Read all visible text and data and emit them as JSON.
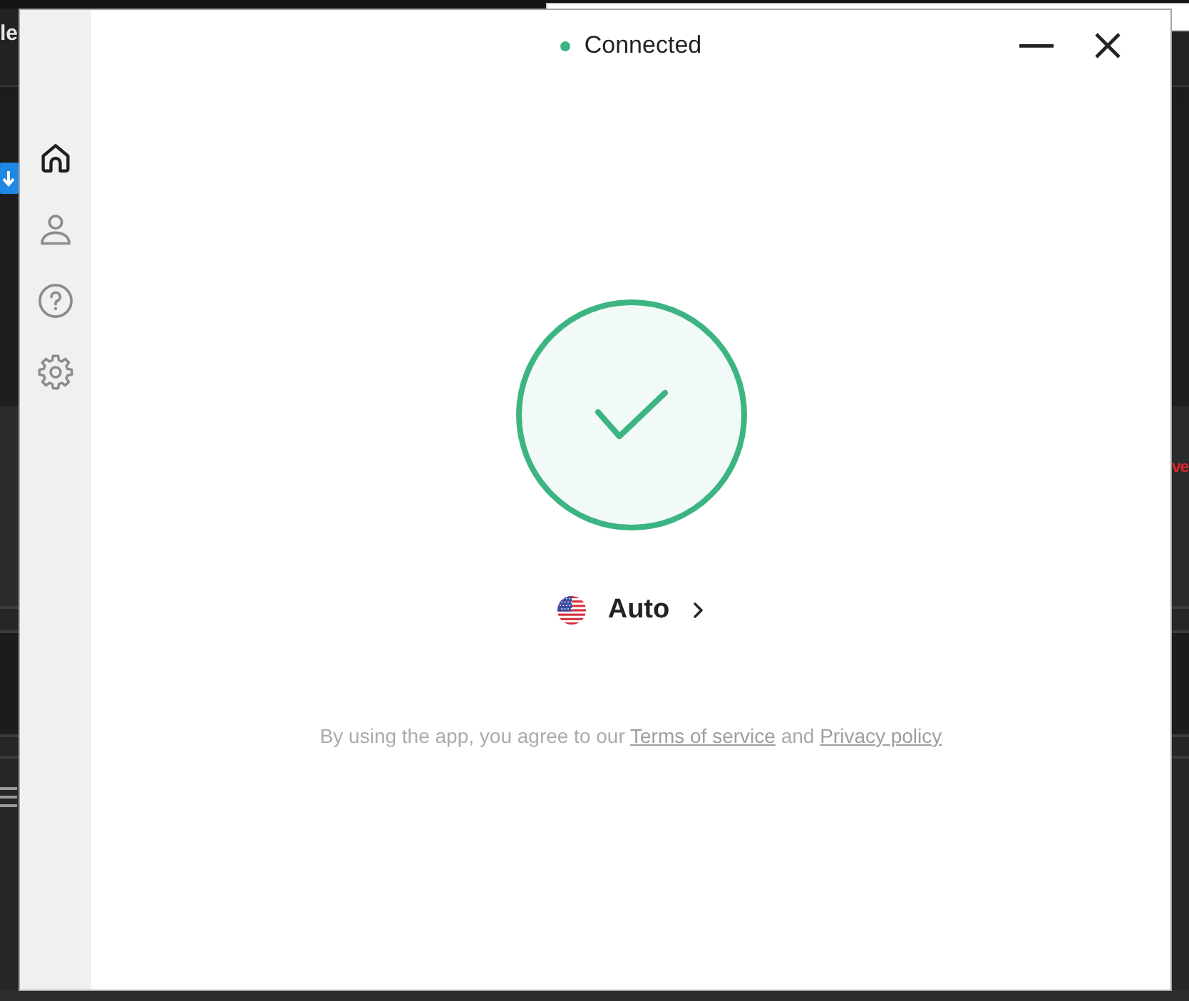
{
  "background_window": {
    "title_fragment": "le",
    "alert_fragment": "ve"
  },
  "sidebar": {
    "items": [
      {
        "kind": "home",
        "selected": true
      },
      {
        "kind": "profile",
        "selected": false
      },
      {
        "kind": "help",
        "selected": false
      },
      {
        "kind": "settings",
        "selected": false
      }
    ]
  },
  "status": {
    "text": "Connected",
    "connected": true
  },
  "location": {
    "label": "Auto"
  },
  "legal": {
    "parts": [
      {
        "kind": "text",
        "text": "By using the app, you agree to our"
      },
      {
        "kind": "link",
        "text": "Terms of service"
      },
      {
        "kind": "text",
        "text": "and"
      },
      {
        "kind": "link",
        "text": "Privacy policy"
      }
    ]
  }
}
